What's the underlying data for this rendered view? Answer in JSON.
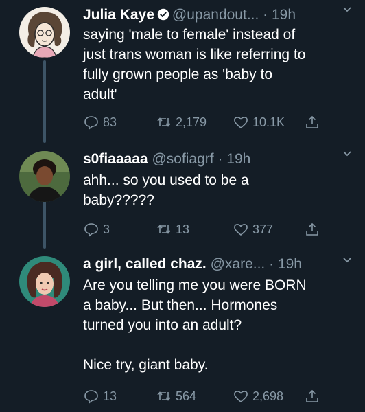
{
  "tweets": [
    {
      "name": "Julia Kaye",
      "verified": true,
      "handle": "@upandout...",
      "time": "· 19h",
      "text": "saying 'male to female' instead of\njust trans woman is like referring to\nfully grown people as 'baby to\nadult'",
      "replies": "83",
      "retweets": "2,179",
      "likes": "10.1K"
    },
    {
      "name": "s0fiaaaaa",
      "verified": false,
      "handle": "@sofiagrf",
      "time": "· 19h",
      "text": "ahh... so you used to be a\nbaby?????",
      "replies": "3",
      "retweets": "13",
      "likes": "377"
    },
    {
      "name": "a girl, called chaz.",
      "verified": false,
      "handle": "@xare...",
      "time": "· 19h",
      "text": "Are you telling me you were BORN\na baby... But then... Hormones\nturned you into an adult?\n\nNice try, giant baby.",
      "replies": "13",
      "retweets": "564",
      "likes": "2,698"
    }
  ],
  "colors": {
    "background": "#141d26",
    "secondary_text": "#8899a6",
    "thread_line": "#3d5466",
    "verified": "#1da1f2"
  }
}
